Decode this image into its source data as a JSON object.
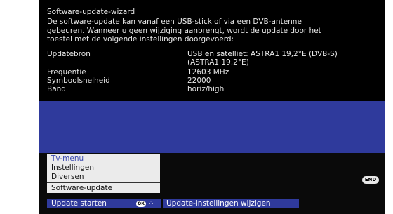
{
  "wizard": {
    "title": "Software-update-wizard",
    "description": "De software-update kan vanaf een USB-stick of via een DVB-antenne\ngebeuren. Wanneer u geen wijziging aanbrengt, wordt de update door het\ntoestel met de volgende instellingen doorgevoerd:",
    "settings": [
      {
        "label": "Updatebron",
        "value": "USB en satelliet: ASTRA1 19,2°E (DVB-S)\n(ASTRA1 19,2°E)"
      },
      {
        "label": "Frequentie",
        "value": "12603 MHz"
      },
      {
        "label": "Symboolsnelheid",
        "value": "22000"
      },
      {
        "label": "Band",
        "value": "horiz/high"
      }
    ]
  },
  "menu": {
    "header": "Tv-menu",
    "items": [
      "Instellingen",
      "Diversen",
      "Software-update"
    ]
  },
  "buttons": {
    "end_label": "END",
    "ok_label": "OK",
    "nav_symbol": "∴",
    "update_start": "Update starten",
    "update_settings": "Update-instellingen wijzigen"
  },
  "colors": {
    "accent_blue": "#2f3a9c",
    "menu_bg": "#ebebeb",
    "menu_header": "#3a4ab0"
  }
}
